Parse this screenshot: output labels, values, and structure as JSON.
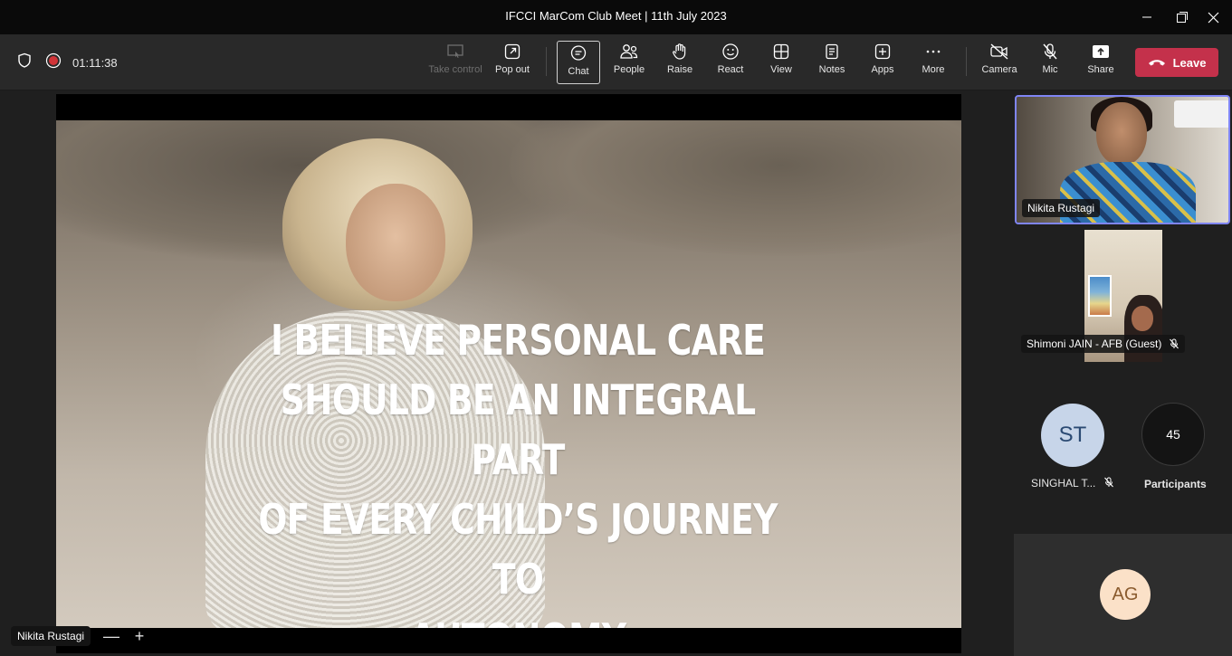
{
  "window": {
    "title": "IFCCI MarCom Club Meet | 11th July 2023"
  },
  "toolbar": {
    "timer": "01:11:38",
    "buttons": {
      "take_control": "Take control",
      "pop_out": "Pop out",
      "chat": "Chat",
      "people": "People",
      "raise": "Raise",
      "react": "React",
      "view": "View",
      "notes": "Notes",
      "apps": "Apps",
      "more": "More",
      "camera": "Camera",
      "mic": "Mic",
      "share": "Share"
    },
    "leave_label": "Leave",
    "leave_color": "#c4314b"
  },
  "stage": {
    "quote_lines": [
      "I BELIEVE PERSONAL CARE",
      "SHOULD BE AN INTEGRAL PART",
      "OF EVERY CHILD’S JOURNEY TO",
      "AUTONOMY"
    ],
    "presenter_name": "Nikita Rustagi",
    "zoom_out_symbol": "—",
    "zoom_in_symbol": "+"
  },
  "participants_panel": {
    "tile1_name": "Nikita Rustagi",
    "tile2_name": "Shimoni JAIN - AFB (Guest)",
    "tile3_initials": "ST",
    "tile3_name": "SINGHAL T...",
    "participants_count": "45",
    "participants_label": "Participants",
    "tile4_initials": "AG",
    "highlight_color": "#7f85f5"
  }
}
